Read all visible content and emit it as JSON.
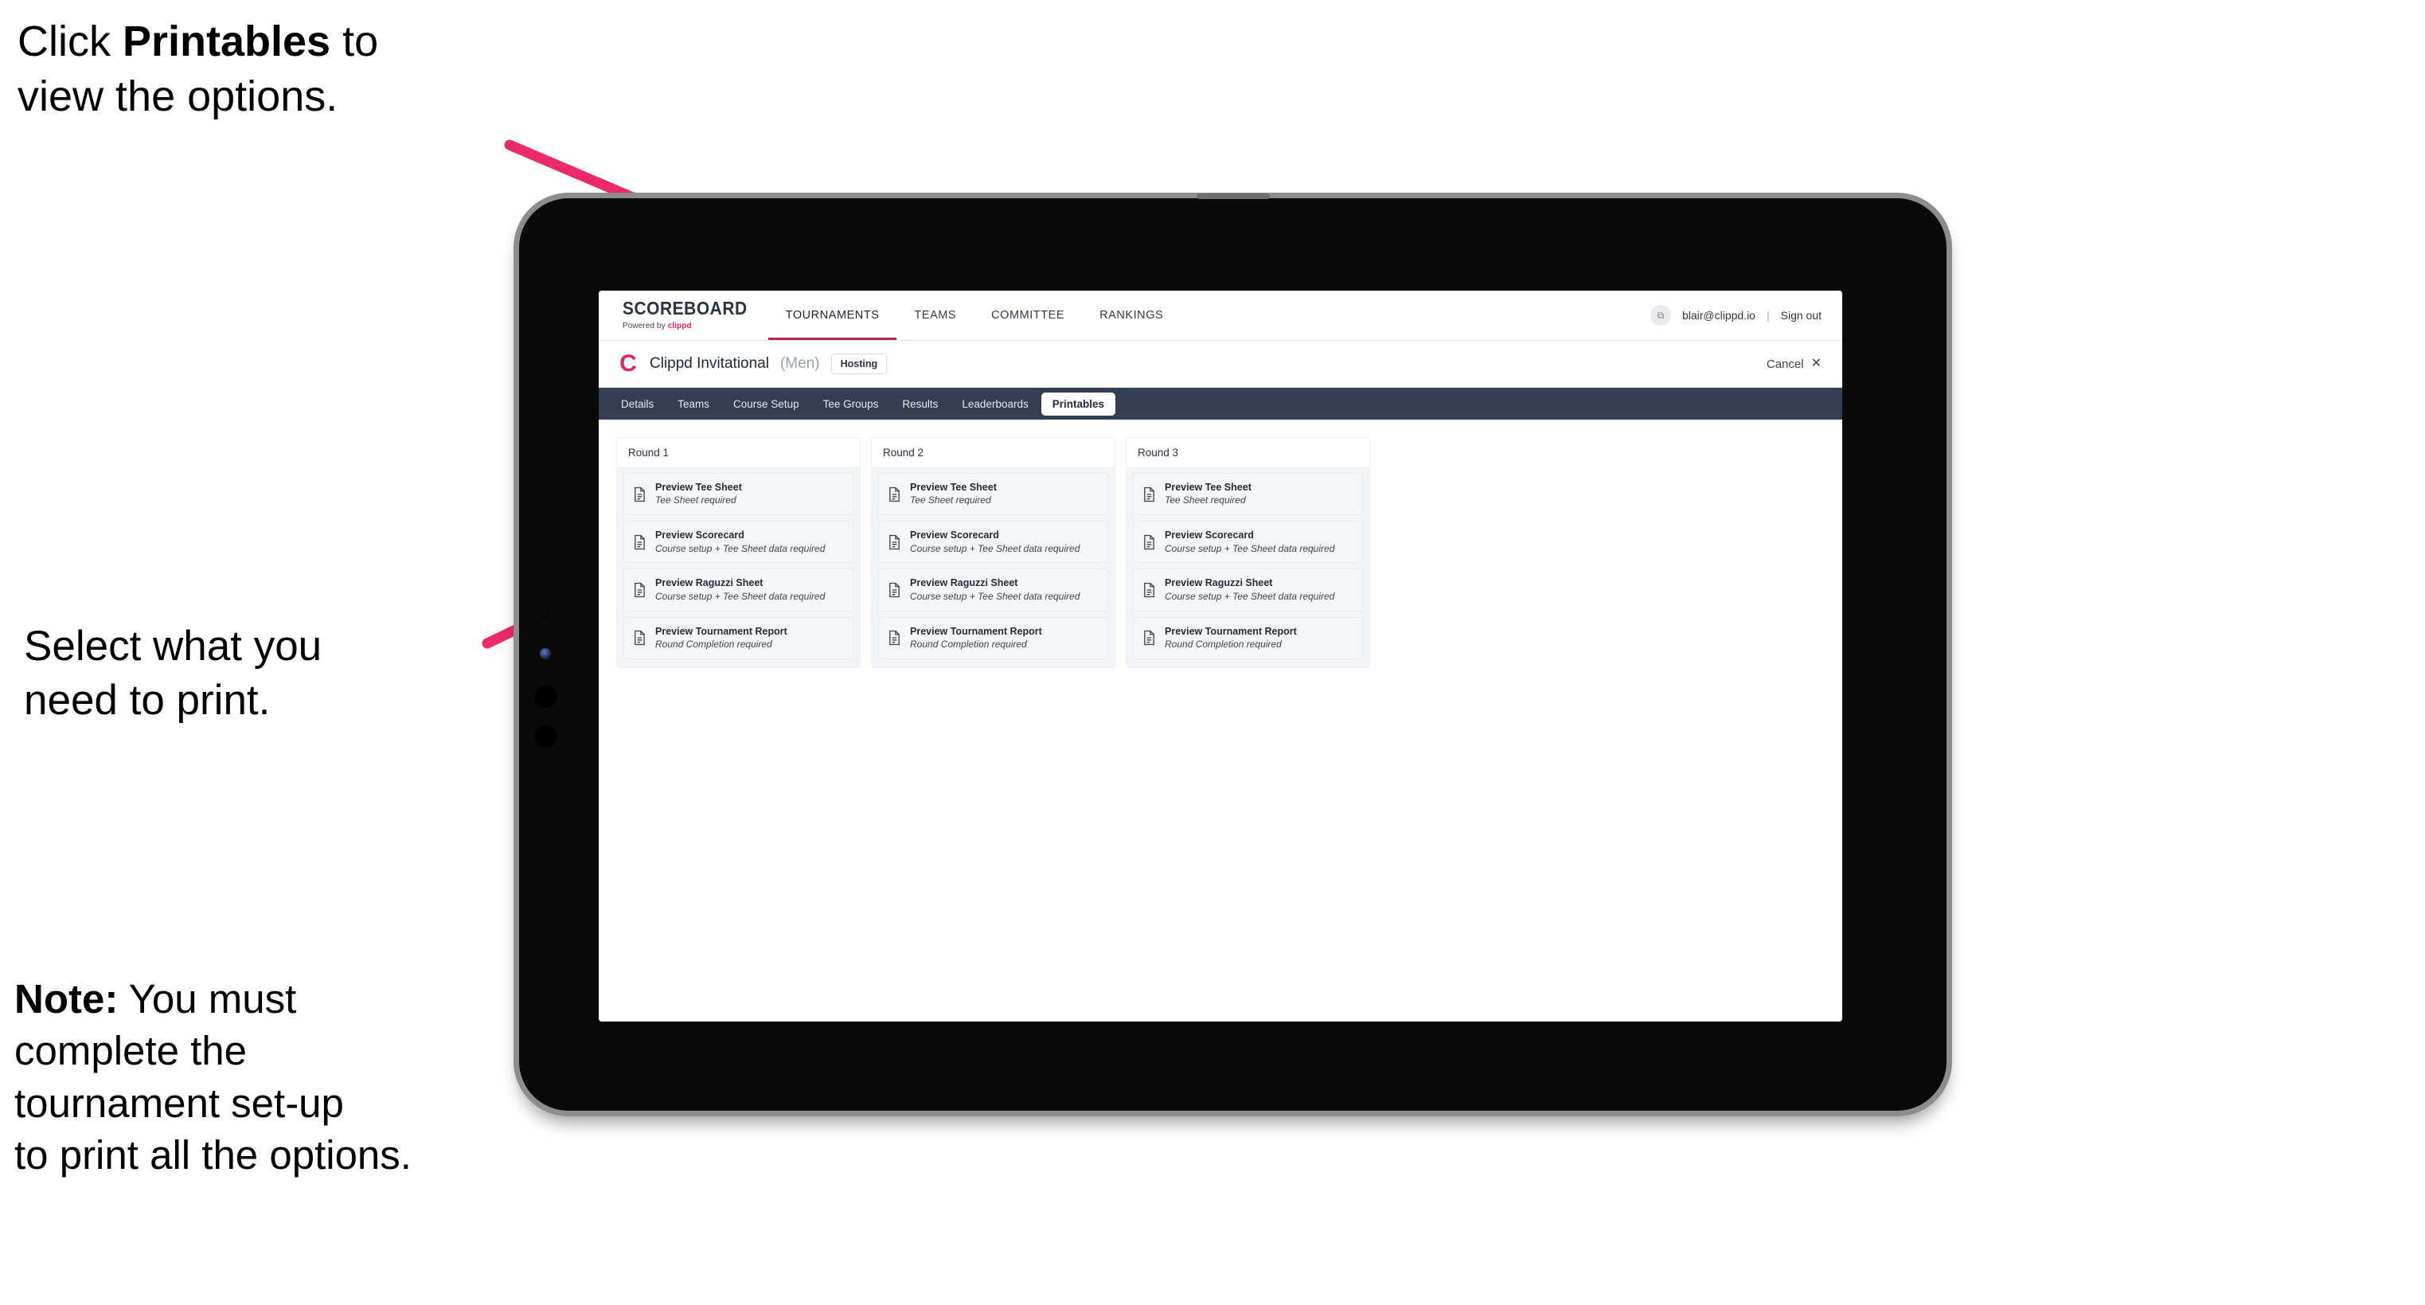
{
  "annotations": {
    "top": {
      "before": "Click ",
      "bold": "Printables",
      "after": " to\nview the options."
    },
    "middle": "Select what you\n need to print.",
    "note": {
      "bold": "Note:",
      "rest": " You must\ncomplete the\ntournament set-up\nto print all the options."
    }
  },
  "colors": {
    "accent_pink": "#e0245e",
    "arrow_pink": "#ec2a68",
    "tabbar_dark": "#333e53",
    "device_black": "#0a0a0a",
    "device_bezel": "#8d8d8d"
  },
  "app": {
    "brand": {
      "title": "SCOREBOARD",
      "sub_prefix": "Powered by ",
      "sub_brand": "clippd"
    },
    "topnav": {
      "items": [
        {
          "label": "TOURNAMENTS",
          "active": true
        },
        {
          "label": "TEAMS",
          "active": false
        },
        {
          "label": "COMMITTEE",
          "active": false
        },
        {
          "label": "RANKINGS",
          "active": false
        }
      ],
      "avatar_glyph": "⧉",
      "user_email": "blair@clippd.io",
      "separator": "|",
      "sign_out": "Sign out"
    },
    "tournament": {
      "logo_letter": "C",
      "name": "Clippd Invitational",
      "gender": "(Men)",
      "status_badge": "Hosting",
      "cancel_label": "Cancel",
      "cancel_icon": "✕"
    },
    "tabs": [
      {
        "label": "Details",
        "active": false
      },
      {
        "label": "Teams",
        "active": false
      },
      {
        "label": "Course Setup",
        "active": false
      },
      {
        "label": "Tee Groups",
        "active": false
      },
      {
        "label": "Results",
        "active": false
      },
      {
        "label": "Leaderboards",
        "active": false
      },
      {
        "label": "Printables",
        "active": true
      }
    ],
    "printables": {
      "rounds": [
        {
          "title": "Round 1",
          "items": [
            {
              "title": "Preview Tee Sheet",
              "sub": "Tee Sheet required"
            },
            {
              "title": "Preview Scorecard",
              "sub": "Course setup + Tee Sheet data required"
            },
            {
              "title": "Preview Raguzzi Sheet",
              "sub": "Course setup + Tee Sheet data required"
            },
            {
              "title": "Preview Tournament Report",
              "sub": "Round Completion required"
            }
          ]
        },
        {
          "title": "Round 2",
          "items": [
            {
              "title": "Preview Tee Sheet",
              "sub": "Tee Sheet required"
            },
            {
              "title": "Preview Scorecard",
              "sub": "Course setup + Tee Sheet data required"
            },
            {
              "title": "Preview Raguzzi Sheet",
              "sub": "Course setup + Tee Sheet data required"
            },
            {
              "title": "Preview Tournament Report",
              "sub": "Round Completion required"
            }
          ]
        },
        {
          "title": "Round 3",
          "items": [
            {
              "title": "Preview Tee Sheet",
              "sub": "Tee Sheet required"
            },
            {
              "title": "Preview Scorecard",
              "sub": "Course setup + Tee Sheet data required"
            },
            {
              "title": "Preview Raguzzi Sheet",
              "sub": "Course setup + Tee Sheet data required"
            },
            {
              "title": "Preview Tournament Report",
              "sub": "Round Completion required"
            }
          ]
        }
      ]
    }
  }
}
